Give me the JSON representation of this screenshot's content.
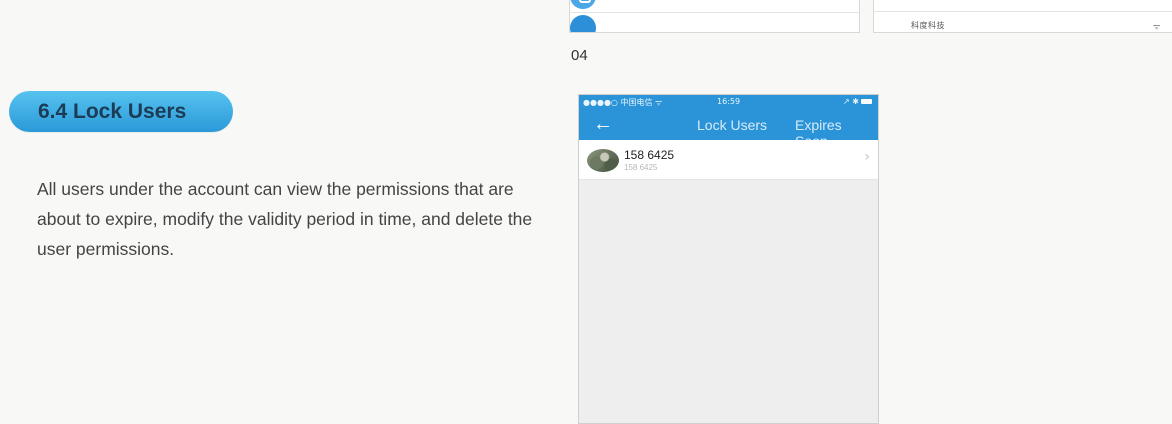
{
  "page_number": "04",
  "top_right_shot": {
    "row_label": "科度科技",
    "wifi_icon": "wifi-icon"
  },
  "section": {
    "heading": "6.4 Lock Users",
    "body": "All users under the account can view the permissions that are about to expire, modify the validity period in time, and delete the user permissions."
  },
  "phone": {
    "status_bar": {
      "carrier": "●●●●○ 中国电信 ᯤ",
      "time": "16:59",
      "right": "↗ ✱"
    },
    "nav": {
      "back_icon": "←",
      "title": "Lock Users",
      "right_action": "Expires Soon"
    },
    "users": [
      {
        "primary": "158      6425",
        "secondary": "158      6425",
        "chevron": "›"
      }
    ]
  },
  "colors": {
    "accent_blue": "#2b93d8",
    "pill_top": "#56c3ef",
    "pill_bottom": "#2a9ad8",
    "pill_text": "#1c3b54"
  }
}
